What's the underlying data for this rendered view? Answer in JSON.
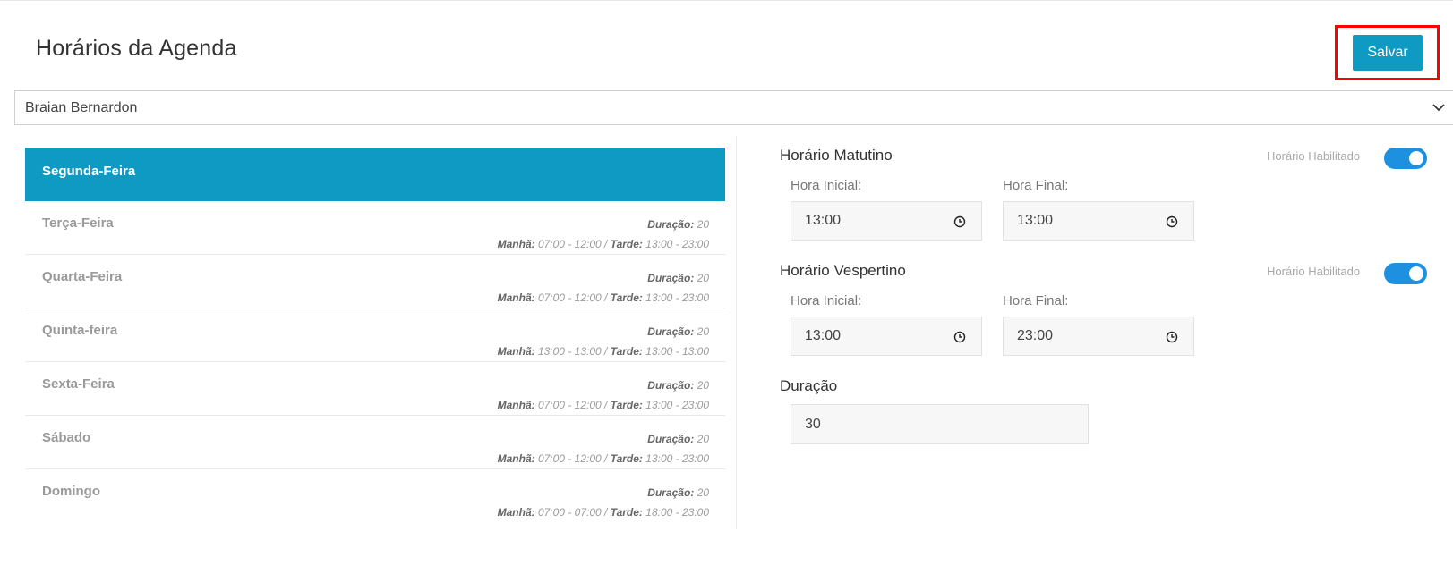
{
  "header": {
    "title": "Horários da Agenda",
    "save_label": "Salvar"
  },
  "professional_select": {
    "selected": "Braian Bernardon"
  },
  "days": [
    {
      "name": "Segunda-Feira",
      "active": true,
      "duracao_label": "",
      "duracao_value": "",
      "manha_label": "",
      "manha_value": "",
      "tarde_label": "",
      "tarde_value": ""
    },
    {
      "name": "Terça-Feira",
      "active": false,
      "duracao_label": "Duração:",
      "duracao_value": "20",
      "manha_label": "Manhã:",
      "manha_value": "07:00 - 12:00 /",
      "tarde_label": "Tarde:",
      "tarde_value": "13:00 - 23:00"
    },
    {
      "name": "Quarta-Feira",
      "active": false,
      "duracao_label": "Duração:",
      "duracao_value": "20",
      "manha_label": "Manhã:",
      "manha_value": "07:00 - 12:00 /",
      "tarde_label": "Tarde:",
      "tarde_value": "13:00 - 23:00"
    },
    {
      "name": "Quinta-feira",
      "active": false,
      "duracao_label": "Duração:",
      "duracao_value": "20",
      "manha_label": "Manhã:",
      "manha_value": "13:00 - 13:00 /",
      "tarde_label": "Tarde:",
      "tarde_value": "13:00 - 13:00"
    },
    {
      "name": "Sexta-Feira",
      "active": false,
      "duracao_label": "Duração:",
      "duracao_value": "20",
      "manha_label": "Manhã:",
      "manha_value": "07:00 - 12:00 /",
      "tarde_label": "Tarde:",
      "tarde_value": "13:00 - 23:00"
    },
    {
      "name": "Sábado",
      "active": false,
      "duracao_label": "Duração:",
      "duracao_value": "20",
      "manha_label": "Manhã:",
      "manha_value": "07:00 - 12:00 /",
      "tarde_label": "Tarde:",
      "tarde_value": "13:00 - 23:00"
    },
    {
      "name": "Domingo",
      "active": false,
      "duracao_label": "Duração:",
      "duracao_value": "20",
      "manha_label": "Manhã:",
      "manha_value": "07:00 - 07:00 /",
      "tarde_label": "Tarde:",
      "tarde_value": "18:00 - 23:00"
    }
  ],
  "matutino": {
    "title": "Horário Matutino",
    "toggle_label": "Horário Habilitado",
    "enabled": true,
    "start_label": "Hora Inicial:",
    "start_value": "13:00",
    "end_label": "Hora Final:",
    "end_value": "13:00"
  },
  "vespertino": {
    "title": "Horário Vespertino",
    "toggle_label": "Horário Habilitado",
    "enabled": true,
    "start_label": "Hora Inicial:",
    "start_value": "13:00",
    "end_label": "Hora Final:",
    "end_value": "23:00"
  },
  "duracao": {
    "title": "Duração",
    "value": "30"
  },
  "colors": {
    "accent": "#0e9ac3",
    "toggle_on": "#1e90e0",
    "highlight": "#ff0000"
  },
  "icons": {
    "select_caret": "chevron-down-icon",
    "time_field": "clock-icon"
  }
}
